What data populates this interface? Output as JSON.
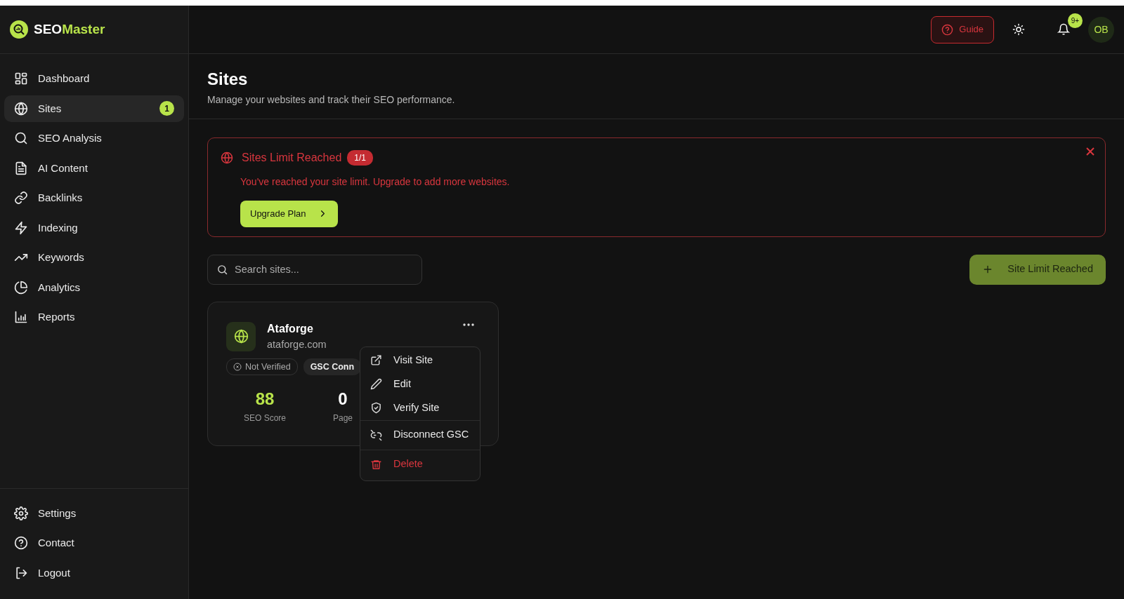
{
  "logo": {
    "text_primary": "SEO",
    "text_accent": "Master"
  },
  "sidebar": {
    "items": [
      {
        "label": "Dashboard",
        "selected": false
      },
      {
        "label": "Sites",
        "selected": true,
        "badge": "1"
      },
      {
        "label": "SEO Analysis",
        "selected": false
      },
      {
        "label": "AI Content",
        "selected": false
      },
      {
        "label": "Backlinks",
        "selected": false
      },
      {
        "label": "Indexing",
        "selected": false
      },
      {
        "label": "Keywords",
        "selected": false
      },
      {
        "label": "Analytics",
        "selected": false
      },
      {
        "label": "Reports",
        "selected": false
      }
    ],
    "footer_items": [
      {
        "label": "Settings"
      },
      {
        "label": "Contact"
      },
      {
        "label": "Logout"
      }
    ]
  },
  "header": {
    "guide_button": "Guide",
    "notification_badge": "9+",
    "avatar": "OB"
  },
  "page": {
    "title": "Sites",
    "subtitle": "Manage your websites and track their SEO performance."
  },
  "alert": {
    "title": "Sites Limit Reached",
    "count": "1/1",
    "message": "You've reached your site limit. Upgrade to add more websites.",
    "button": "Upgrade Plan"
  },
  "search": {
    "placeholder": "Search sites..."
  },
  "add_button": {
    "label": "Site Limit Reached",
    "disabled": true
  },
  "sites": [
    {
      "name": "Ataforge",
      "domain": "ataforge.com",
      "verified": false,
      "verification_label": "Not Verified",
      "gsc_label": "GSC Conn",
      "stats": [
        {
          "value": "88",
          "label": "SEO Score",
          "highlight": true
        },
        {
          "value": "0",
          "label": "Page",
          "highlight": false
        }
      ]
    }
  ],
  "context_menu": {
    "items": [
      {
        "label": "Visit Site",
        "kind": "normal",
        "separated": false
      },
      {
        "label": "Edit",
        "kind": "normal",
        "separated": false
      },
      {
        "label": "Verify Site",
        "kind": "normal",
        "separated": false
      },
      {
        "label": "Disconnect GSC",
        "kind": "normal",
        "separated": true
      },
      {
        "label": "Delete",
        "kind": "danger",
        "separated": true
      }
    ]
  }
}
